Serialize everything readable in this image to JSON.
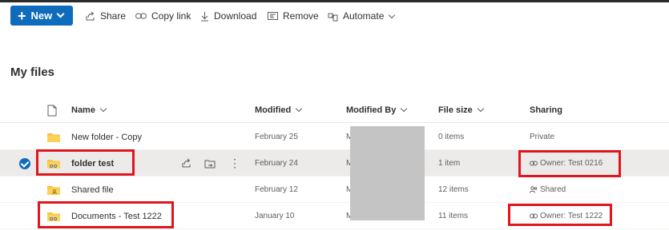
{
  "toolbar": {
    "new_label": "New",
    "share_label": "Share",
    "copy_link_label": "Copy link",
    "download_label": "Download",
    "remove_label": "Remove",
    "automate_label": "Automate"
  },
  "page": {
    "title": "My files"
  },
  "columns": {
    "name": "Name",
    "modified": "Modified",
    "modified_by": "Modified By",
    "file_size": "File size",
    "sharing": "Sharing"
  },
  "rows": [
    {
      "name": "New folder - Copy",
      "modified": "February 25",
      "modified_by": "M",
      "size": "0 items",
      "sharing": "Private",
      "selected": false
    },
    {
      "name": "folder test",
      "modified": "February 24",
      "modified_by": "M",
      "size": "1 item",
      "sharing": "Owner: Test 0216",
      "selected": true
    },
    {
      "name": "Shared file",
      "modified": "February 12",
      "modified_by": "M",
      "size": "12 items",
      "sharing": "Shared",
      "selected": false
    },
    {
      "name": "Documents - Test 1222",
      "modified": "January 10",
      "modified_by": "M",
      "size": "11 items",
      "sharing": "Owner: Test 1222",
      "selected": false
    }
  ],
  "colors": {
    "accent": "#0f6cbd",
    "folder": "#f5c342",
    "highlight": "#e0161e"
  }
}
